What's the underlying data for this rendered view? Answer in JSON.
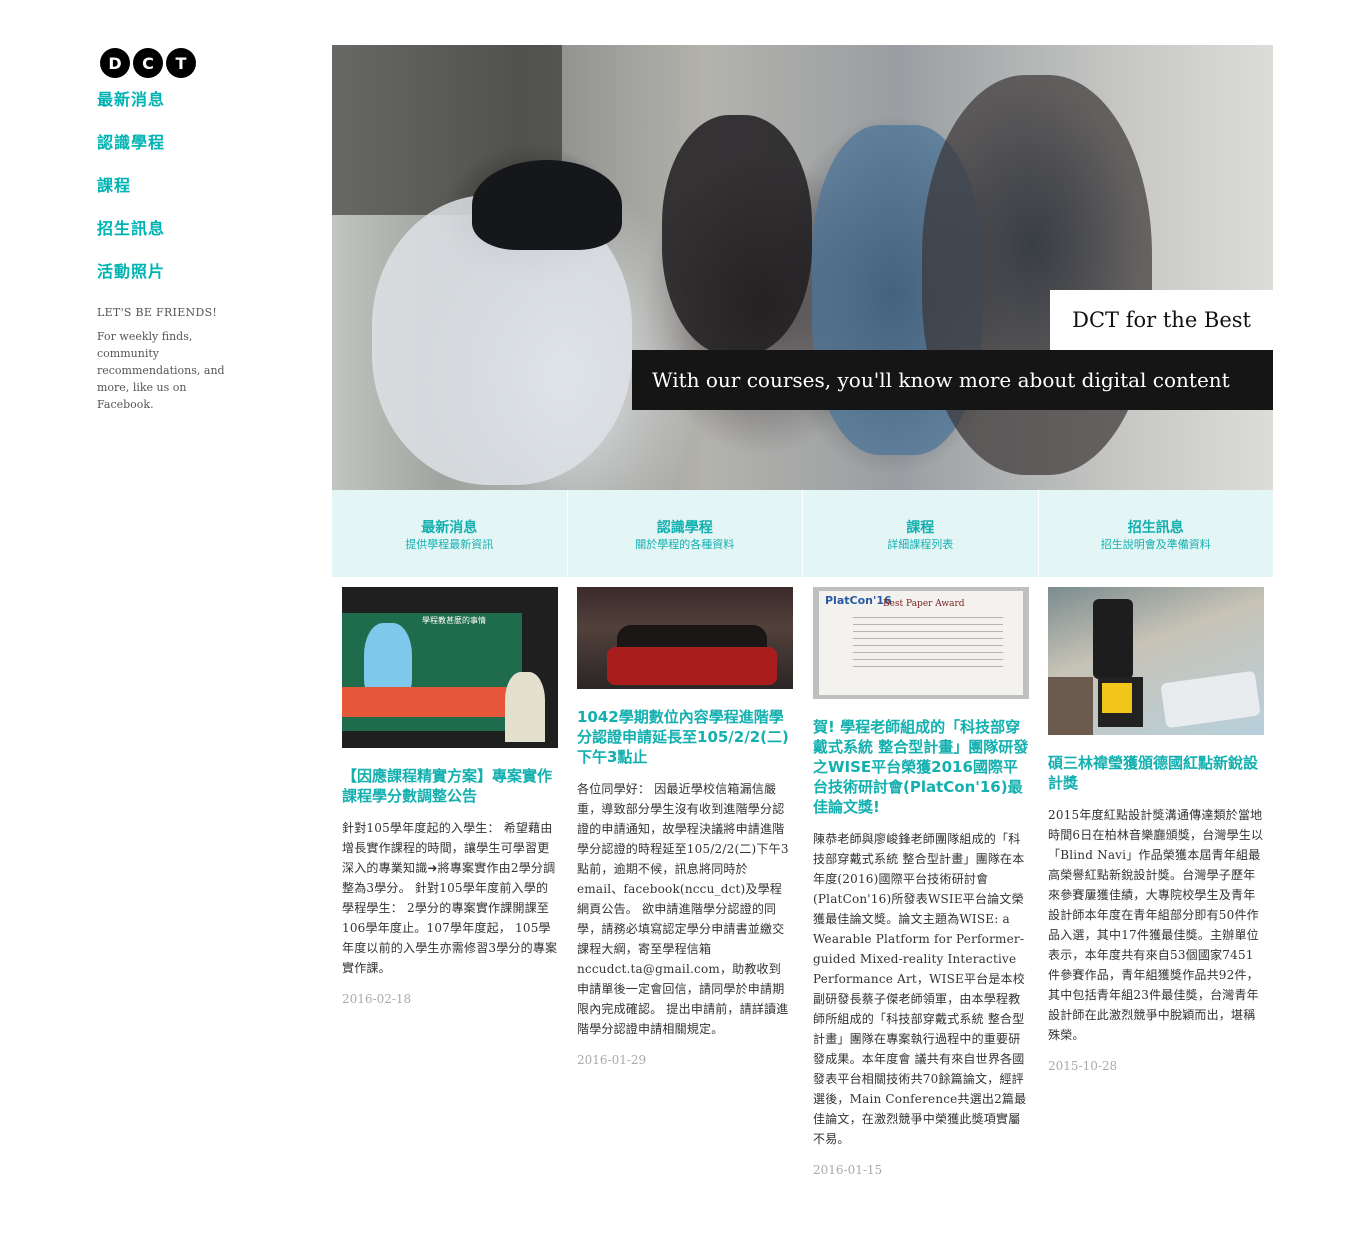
{
  "sidebar": {
    "logo": [
      "D",
      "C",
      "T"
    ],
    "nav": [
      "最新消息",
      "認識學程",
      "課程",
      "招生訊息",
      "活動照片"
    ],
    "friends_title": "LET'S BE FRIENDS!",
    "friends_text": "For weekly finds, community recommendations, and more, like us on Facebook."
  },
  "hero": {
    "caption_top": "DCT for the Best",
    "caption_bottom": "With our courses, you'll know more about digital content"
  },
  "features": [
    {
      "title": "最新消息",
      "sub": "提供學程最新資訊"
    },
    {
      "title": "認識學程",
      "sub": "關於學程的各種資料"
    },
    {
      "title": "課程",
      "sub": "詳細課程列表"
    },
    {
      "title": "招生訊息",
      "sub": "招生說明會及準備資料"
    }
  ],
  "articles": [
    {
      "title": "【因應課程精實方案】專案實作課程學分數調整公告",
      "body": "針對105學年度起的入學生： 希望藉由增長實作課程的時間，讓學生可學習更深入的專業知識➜將專案實作由2學分調整為3學分。 針對105學年度前入學的學程學生： 2學分的專案實作課開課至106學年度止。107學年度起， 105學年度以前的入學生亦需修習3學分的專案實作課。",
      "date": "2016-02-18",
      "thumb_label": "學程教甚麼的事情"
    },
    {
      "title": "1042學期數位內容學程進階學分認證申請延長至105/2/2(二)下午3點止",
      "body": "各位同學好： 因最近學校信箱漏信嚴重，導致部分學生沒有收到進階學分認證的申請通知，故學程決議將申請進階學分認證的時程延至105/2/2(二)下午3點前，逾期不候，訊息將同時於email、facebook(nccu_dct)及學程網頁公告。 欲申請進階學分認證的同學，請務必填寫認定學分申請書並繳交課程大綱，寄至學程信箱nccudct.ta@gmail.com，助教收到申請單後一定會回信，請同學於申請期限內完成確認。 提出申請前，請詳讀進階學分認證申請相關規定。",
      "date": "2016-01-29"
    },
    {
      "title": "賀! 學程老師組成的「科技部穿戴式系統 整合型計畫」團隊研發之WISE平台榮獲2016國際平台技術研討會(PlatCon'16)最佳論文獎!",
      "body": "陳恭老師與廖峻鋒老師團隊組成的「科技部穿戴式系統 整合型計畫」團隊在本年度(2016)國際平台技術研討會(PlatCon'16)所發表WSIE平台論文榮獲最佳論文獎。論文主題為WISE: a Wearable Platform for Performer-guided Mixed-reality Interactive Performance Art，WISE平台是本校副研發長蔡子傑老師領軍，由本學程教師所組成的「科技部穿戴式系統 整合型計畫」團隊在專案執行過程中的重要研發成果。本年度會 議共有來自世界各國 發表平台相關技術共70餘篇論文，經評選後，Main Conference共選出2篇最佳論文，在激烈競爭中榮獲此獎項實屬不易。",
      "date": "2016-01-15",
      "thumb_logo": "PlatCon'16",
      "thumb_award": "Best Paper Award"
    },
    {
      "title": "碩三林禕瑩獲頒德國紅點新銳設計獎",
      "body": "2015年度紅點設計獎溝通傳達類於當地時間6日在柏林音樂廳頒獎，台灣學生以「Blind Navi」作品榮獲本屆青年組最高榮譽紅點新銳設計獎。台灣學子歷年來參賽屢獲佳績，大專院校學生及青年設計師本年度在青年組部分即有50件作品入選，其中17件獲最佳獎。主辦單位表示，本年度共有來自53個國家7451件參賽作品，青年組獲獎作品共92件，其中包括青年組23件最佳獎，台灣青年設計師在此激烈競爭中脫穎而出，堪稱殊榮。",
      "date": "2015-10-28"
    }
  ]
}
